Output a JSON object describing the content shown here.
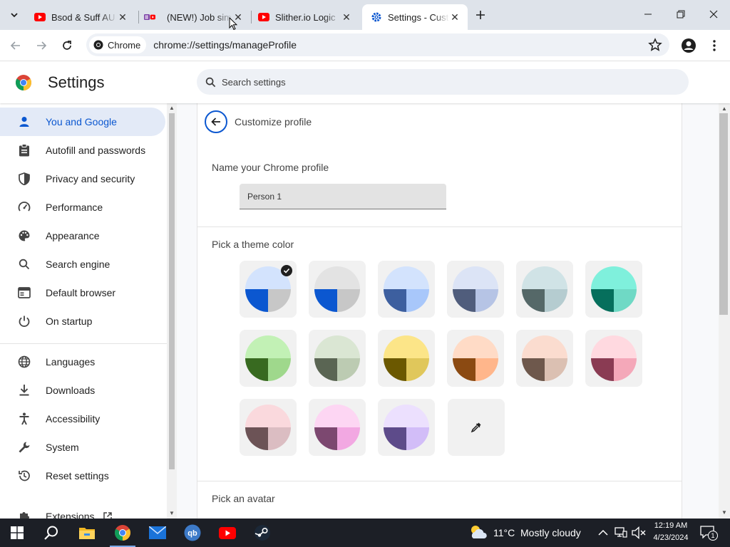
{
  "browser": {
    "tabs": [
      {
        "title": "Bsod & Suff AU",
        "icon": "youtube-icon"
      },
      {
        "title": "(NEW!) Job sim",
        "icon": "playlist-icon"
      },
      {
        "title": "Slither.io Logic",
        "icon": "youtube-icon"
      },
      {
        "title": "Settings - Customize profile",
        "icon": "gear-icon",
        "active": true
      }
    ],
    "chip_label": "Chrome",
    "url": "chrome://settings/manageProfile"
  },
  "settings": {
    "title": "Settings",
    "search_placeholder": "Search settings",
    "nav": [
      {
        "label": "You and Google",
        "icon": "person-icon",
        "active": true
      },
      {
        "label": "Autofill and passwords",
        "icon": "clipboard-icon"
      },
      {
        "label": "Privacy and security",
        "icon": "shield-icon"
      },
      {
        "label": "Performance",
        "icon": "speedometer-icon"
      },
      {
        "label": "Appearance",
        "icon": "palette-icon"
      },
      {
        "label": "Search engine",
        "icon": "search-icon"
      },
      {
        "label": "Default browser",
        "icon": "browser-icon"
      },
      {
        "label": "On startup",
        "icon": "power-icon"
      },
      {
        "label": "Languages",
        "icon": "globe-icon"
      },
      {
        "label": "Downloads",
        "icon": "download-icon"
      },
      {
        "label": "Accessibility",
        "icon": "accessibility-icon"
      },
      {
        "label": "System",
        "icon": "wrench-icon"
      },
      {
        "label": "Reset settings",
        "icon": "reset-icon"
      },
      {
        "label": "Extensions",
        "icon": "puzzle-icon"
      }
    ]
  },
  "profile": {
    "page_title": "Customize profile",
    "name_label": "Name your Chrome profile",
    "name_value": "Person 1",
    "theme_label": "Pick a theme color",
    "avatar_label": "Pick an avatar",
    "themes": [
      {
        "name": "default",
        "bg": "#d3e3fd",
        "dark": "#0b57d0",
        "light": "#c7c7c7",
        "selected": true
      },
      {
        "name": "grey",
        "bg": "#e3e3e3",
        "dark": "#0b57d0",
        "light": "#c7c7c7"
      },
      {
        "name": "blue",
        "bg": "#d3e3fd",
        "dark": "#3d5f9f",
        "light": "#a8c7fa"
      },
      {
        "name": "navy",
        "bg": "#dce4f6",
        "dark": "#505d7c",
        "light": "#b6c4e5"
      },
      {
        "name": "slate",
        "bg": "#d0e3e6",
        "dark": "#556868",
        "light": "#b5ccd0"
      },
      {
        "name": "aqua",
        "bg": "#7ff0dc",
        "dark": "#066f5c",
        "light": "#6fd9c5"
      },
      {
        "name": "green",
        "bg": "#c2f1b5",
        "dark": "#386a20",
        "light": "#9fd88c"
      },
      {
        "name": "sage",
        "bg": "#dae6d3",
        "dark": "#5a6553",
        "light": "#bccbb2"
      },
      {
        "name": "yellow",
        "bg": "#fce588",
        "dark": "#6b5800",
        "light": "#e0c75b"
      },
      {
        "name": "orange",
        "bg": "#ffdbc6",
        "dark": "#8b4a12",
        "light": "#ffb68b"
      },
      {
        "name": "tan",
        "bg": "#fbdccf",
        "dark": "#6e584c",
        "light": "#dbc0b2"
      },
      {
        "name": "rose",
        "bg": "#ffd9e0",
        "dark": "#8a3b53",
        "light": "#f4a8b9"
      },
      {
        "name": "blush",
        "bg": "#fad9dd",
        "dark": "#6c5356",
        "light": "#dbbdc2"
      },
      {
        "name": "pink",
        "bg": "#fdd6f3",
        "dark": "#7c4870",
        "light": "#f2a8e2"
      },
      {
        "name": "lavender",
        "bg": "#ece0fe",
        "dark": "#5d4b8a",
        "light": "#d2bdf8"
      }
    ],
    "custom_color_icon": "eyedropper-icon"
  },
  "taskbar": {
    "weather_temp": "11°C",
    "weather_text": "Mostly cloudy",
    "time": "12:19 AM",
    "date": "4/23/2024",
    "notif_count": "1"
  }
}
